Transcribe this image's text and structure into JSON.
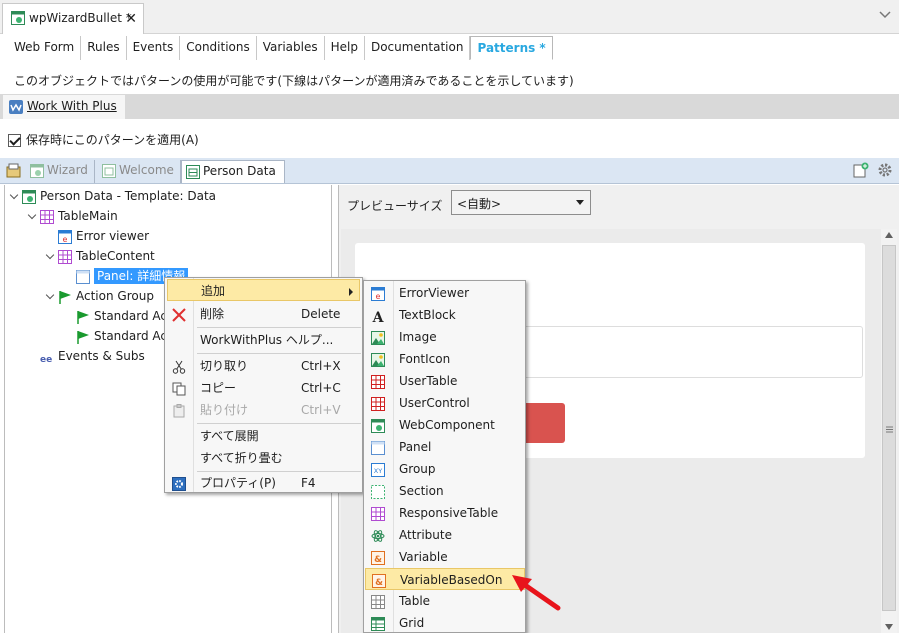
{
  "doc_tab": {
    "title": "wpWizardBullet *",
    "close": "✕"
  },
  "part_tabs": [
    "Web Form",
    "Rules",
    "Events",
    "Conditions",
    "Variables",
    "Help",
    "Documentation",
    "Patterns *"
  ],
  "active_part_tab": "Patterns *",
  "info_text": "このオブジェクトではパターンの使用が可能です(下線はパターンが適用済みであることを示しています)",
  "instance_tab": "Work With Plus",
  "apply_checkbox": {
    "label": "保存時にこのパターンを適用(A)",
    "checked": true
  },
  "view_tabs": [
    "Wizard",
    "Welcome",
    "Person Data"
  ],
  "active_view_tab": "Person Data",
  "tree": {
    "root": "Person Data - Template: Data",
    "table_main": "TableMain",
    "error_viewer": "Error viewer",
    "table_content": "TableContent",
    "panel": "Panel: 詳細情報",
    "action_group": "Action Group",
    "standard_1": "Standard Ac",
    "standard_2": "Standard Ac",
    "events": "Events & Subs"
  },
  "preview": {
    "size_label": "プレビューサイズ",
    "size_value": "<自動>"
  },
  "context_menu": {
    "add": "追加",
    "delete": "削除",
    "delete_key": "Delete",
    "wwp_help": "WorkWithPlus ヘルプ...",
    "cut": "切り取り",
    "cut_key": "Ctrl+X",
    "copy": "コピー",
    "copy_key": "Ctrl+C",
    "paste": "貼り付け",
    "paste_key": "Ctrl+V",
    "expand_all": "すべて展開",
    "collapse_all": "すべて折り畳む",
    "properties": "プロパティ(P)",
    "properties_key": "F4"
  },
  "submenu": [
    "ErrorViewer",
    "TextBlock",
    "Image",
    "FontIcon",
    "UserTable",
    "UserControl",
    "WebComponent",
    "Panel",
    "Group",
    "Section",
    "ResponsiveTable",
    "Attribute",
    "Variable",
    "VariableBasedOn",
    "Table",
    "Grid"
  ],
  "submenu_highlighted": "VariableBasedOn",
  "colors": {
    "accent": "#29a8e0",
    "selection": "#3399ff",
    "menu_highlight": "#fdeaa5",
    "arrow": "#e8141b",
    "preview_button": "#d9534f"
  }
}
